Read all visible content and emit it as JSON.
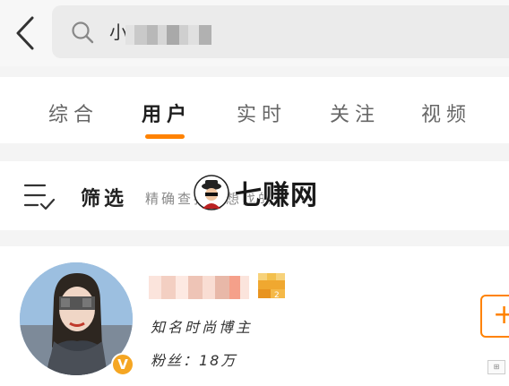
{
  "header": {
    "back_icon": "chevron-left-icon",
    "search_icon": "search-icon",
    "search_value": "小"
  },
  "tabs": [
    {
      "label": "综合",
      "active": false
    },
    {
      "label": "用户",
      "active": true
    },
    {
      "label": "实时",
      "active": false
    },
    {
      "label": "关注",
      "active": false
    },
    {
      "label": "视频",
      "active": false
    }
  ],
  "filter": {
    "icon": "filter-list-icon",
    "label": "筛选",
    "description": "精确查找你想找的人"
  },
  "watermark": {
    "text": "七赚网"
  },
  "result": {
    "description": "知名时尚博主",
    "fans": "粉丝：18万",
    "verified_icon": "verified-v-icon",
    "follow_label": "+"
  },
  "colors": {
    "accent": "#ff8200",
    "verified": "#f5a623",
    "page_bg": "#f4f4f4"
  }
}
